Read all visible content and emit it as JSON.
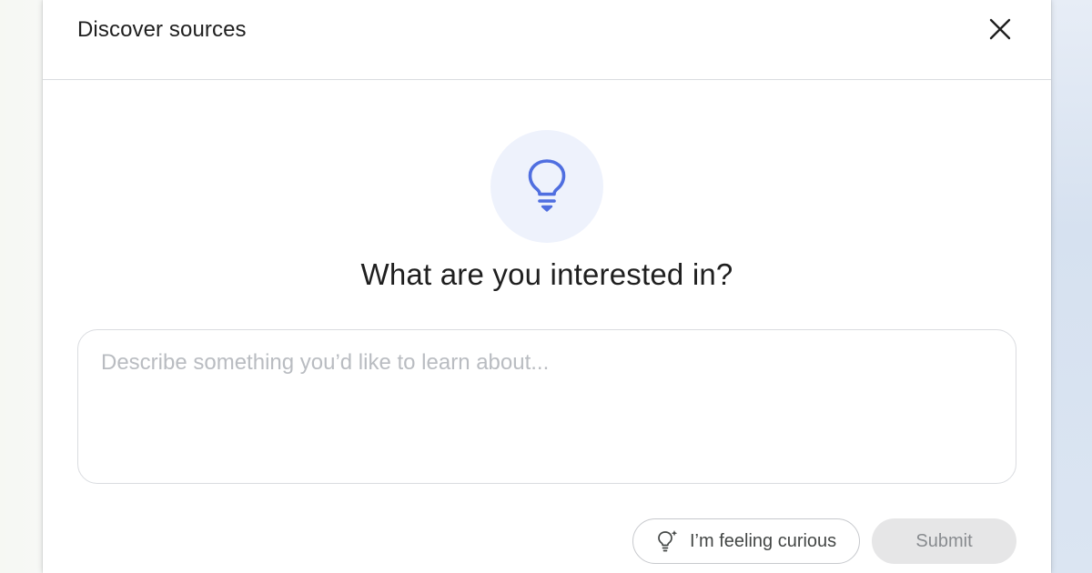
{
  "dialog": {
    "title": "Discover sources",
    "close_icon": "close-icon"
  },
  "hero": {
    "icon": "lightbulb-icon",
    "heading": "What are you interested in?"
  },
  "input": {
    "value": "",
    "placeholder": "Describe something you’d like to learn about..."
  },
  "actions": {
    "curious_icon": "lightbulb-sparkle-icon",
    "curious_label": "I’m feeling curious",
    "submit_label": "Submit"
  },
  "colors": {
    "accent": "#4f6ee0",
    "accent_bg": "#eef2fc",
    "text": "#1f1f1f",
    "placeholder": "#b9bcc1",
    "submit_bg": "#e6e6e7"
  }
}
